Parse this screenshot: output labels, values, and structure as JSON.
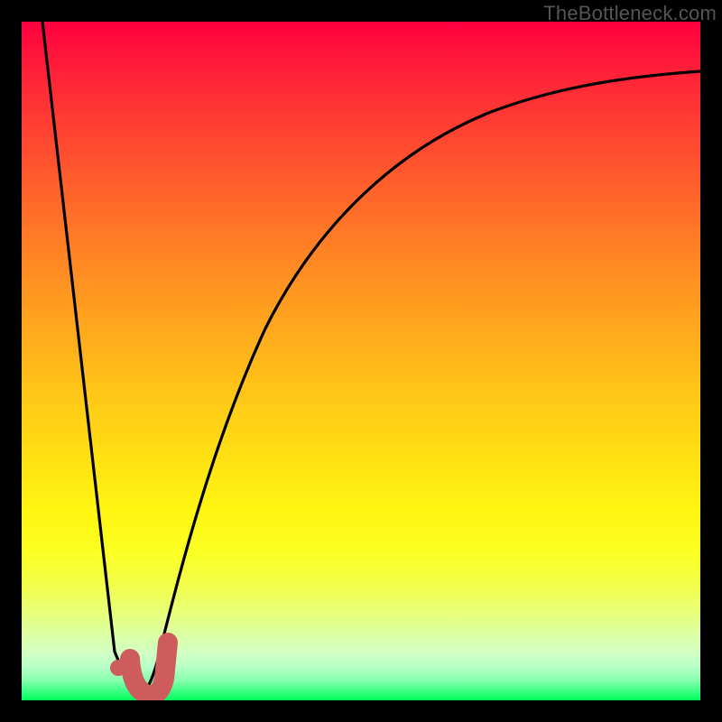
{
  "watermark": "TheBottleneck.com",
  "colors": {
    "background_frame": "#000000",
    "curve": "#000000",
    "marker_stroke": "#cf5c5c",
    "marker_fill": "#cf5c5c",
    "gradient_top": "#ff0040",
    "gradient_mid": "#ffe013",
    "gradient_bottom": "#00ff59"
  },
  "chart_data": {
    "type": "line",
    "title": "",
    "xlabel": "",
    "ylabel": "",
    "xlim": [
      0,
      100
    ],
    "ylim": [
      0,
      100
    ],
    "grid": false,
    "legend": false,
    "notes": "Bottleneck-style curve. Y-axis is inverted visually (0 at bottom is best / green, 100 at top is worst / red). Single black curve descends sharply from top-left to a minimum near x≈17 then rises asymptotically toward y≈92 at right. A salmon J-shaped marker highlights the minimum region around x≈15–20. All x/y values are estimated from the plot (no axis tick labels are shown).",
    "series": [
      {
        "name": "bottleneck-curve",
        "x": [
          3,
          6,
          9,
          12,
          14,
          15,
          16,
          17,
          18,
          19,
          20,
          22,
          25,
          28,
          32,
          38,
          45,
          55,
          70,
          85,
          100
        ],
        "y": [
          100,
          78,
          55,
          32,
          16,
          9,
          4,
          1,
          1,
          4,
          10,
          22,
          38,
          50,
          60,
          70,
          78,
          84,
          88,
          90,
          92
        ]
      }
    ],
    "marker": {
      "name": "optimal-j-marker",
      "dot": {
        "x": 14.5,
        "y": 4
      },
      "hook": [
        {
          "x": 16.0,
          "y": 6.0
        },
        {
          "x": 16.5,
          "y": 2.0
        },
        {
          "x": 18.5,
          "y": 0.5
        },
        {
          "x": 20.0,
          "y": 2.5
        },
        {
          "x": 20.5,
          "y": 8.5
        }
      ]
    }
  }
}
